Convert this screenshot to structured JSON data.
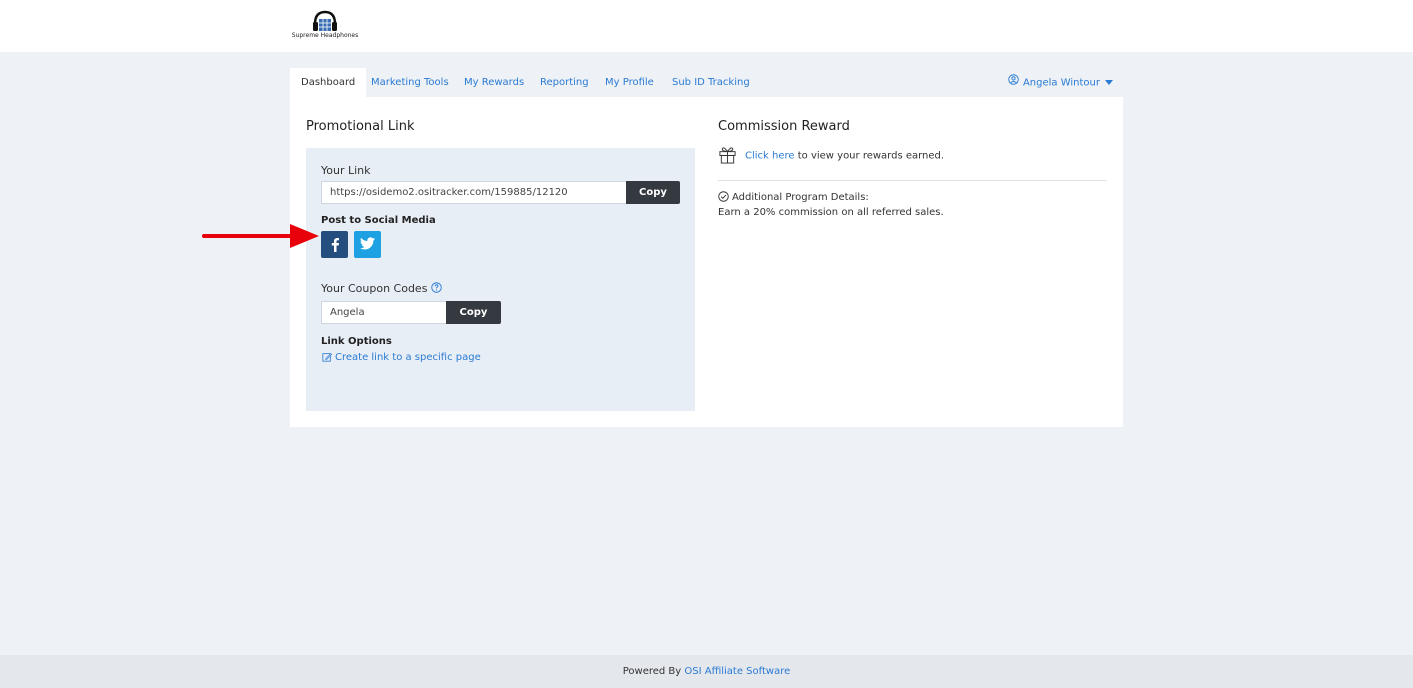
{
  "brand": {
    "name": "Supreme Headphones"
  },
  "nav": {
    "tabs": [
      "Dashboard",
      "Marketing Tools",
      "My Rewards",
      "Reporting",
      "My Profile",
      "Sub ID Tracking"
    ],
    "active_tab": "Dashboard",
    "user_name": "Angela Wintour"
  },
  "promo": {
    "title": "Promotional Link",
    "your_link_label": "Your Link",
    "link_value": "https://osidemo2.ositracker.com/159885/12120",
    "copy_label": "Copy",
    "social_label": "Post to Social Media",
    "social_icons": [
      "facebook-icon",
      "twitter-icon"
    ],
    "coupon_label": "Your Coupon Codes",
    "coupon_value": "Angela",
    "coupon_copy_label": "Copy",
    "link_options_label": "Link Options",
    "create_link_label": "Create link to a specific page"
  },
  "commission": {
    "title": "Commission Reward",
    "click_here": "Click here",
    "view_rewards_text": " to view your rewards earned.",
    "details_label": "Additional Program Details:",
    "details_text": "Earn a 20% commission on all referred sales."
  },
  "footer": {
    "powered_by": "Powered By ",
    "software_name": "OSI Affiliate Software"
  },
  "colors": {
    "accent": "#2a7bd3",
    "facebook": "#234e7d",
    "twitter": "#1da1e2",
    "button_dark": "#343a40",
    "annotation_arrow": "#e8000b"
  }
}
